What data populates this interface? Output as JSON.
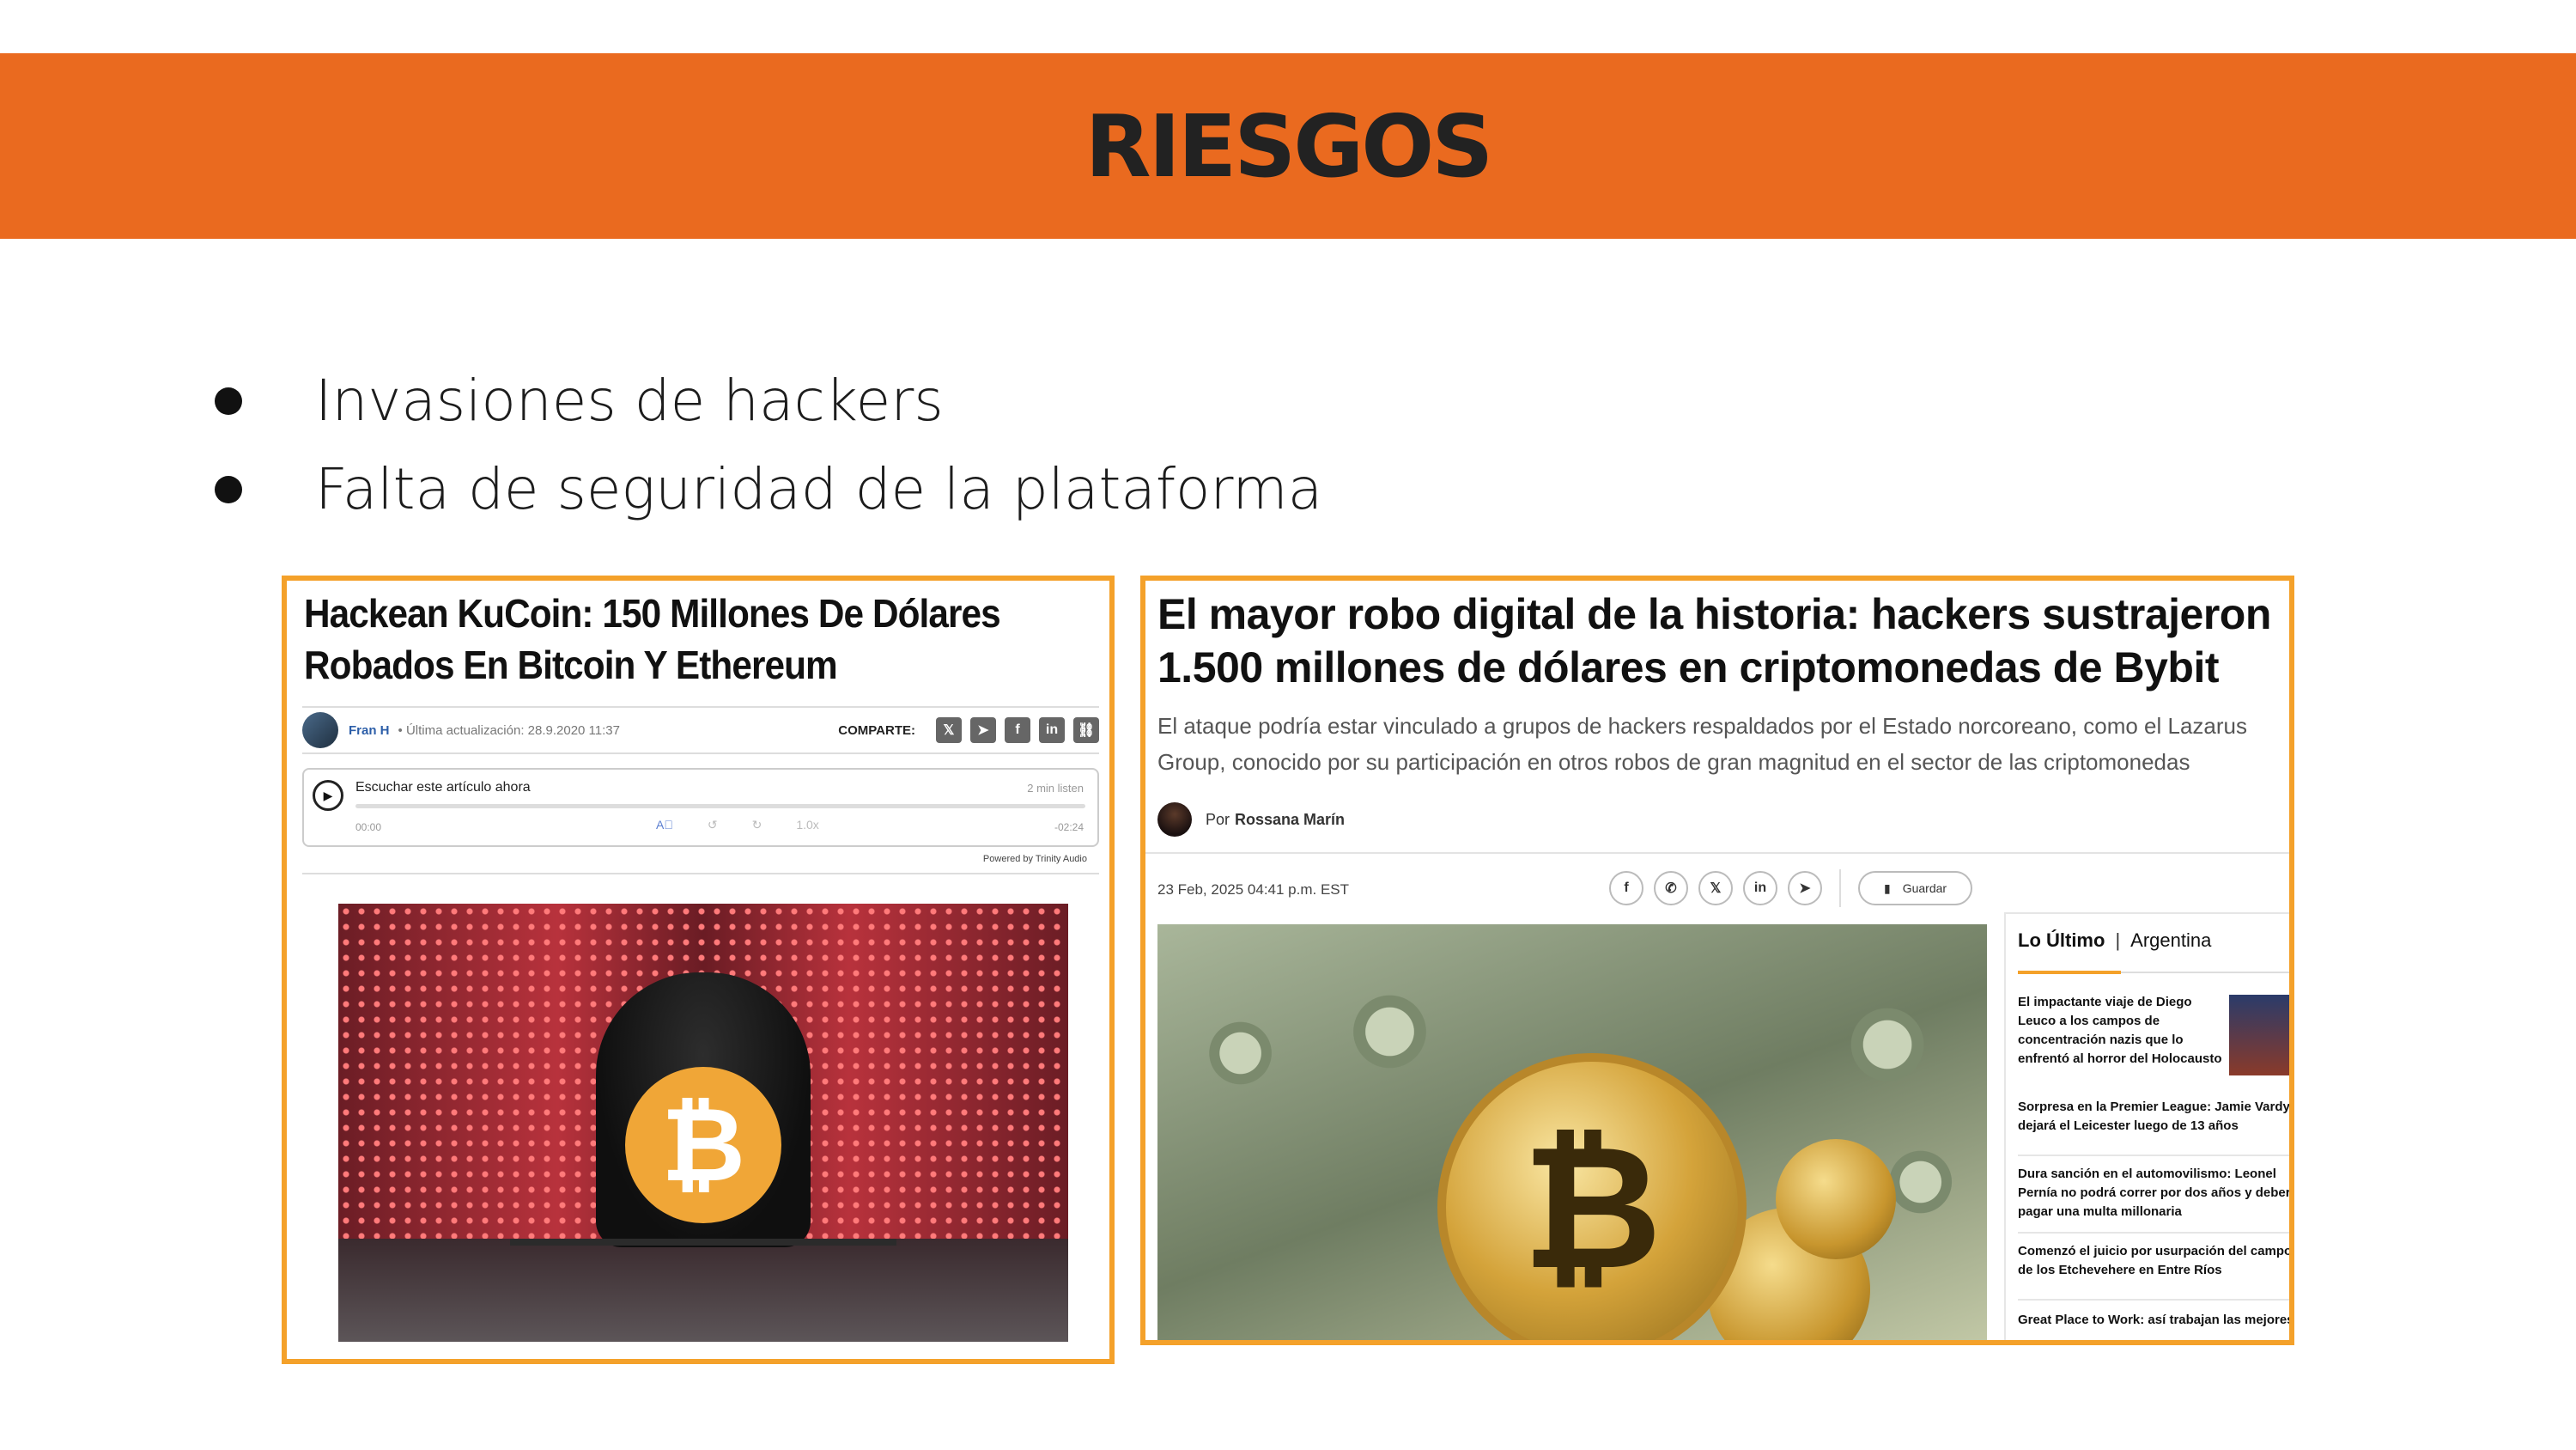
{
  "slide": {
    "title": "RIESGOS",
    "bullets": [
      "Invasiones de hackers",
      "Falta de seguridad de la plataforma"
    ]
  },
  "article1": {
    "title": "Hackean KuCoin: 150 Millones De Dólares Robados En Bitcoin Y Ethereum",
    "author": "Fran H",
    "updated": "Última actualización: 28.9.2020 11:37",
    "share_label": "COMPARTE:",
    "audio": {
      "label": "Escuchar este artículo ahora",
      "length": "2 min listen",
      "start": "00:00",
      "end": "-02:24",
      "speed": "1.0x"
    },
    "powered_by": "Powered by Trinity Audio"
  },
  "article2": {
    "title": "El mayor robo digital de la historia: hackers sustrajeron 1.500 millones de dólares en criptomonedas de Bybit",
    "subtitle": "El ataque podría estar vinculado a grupos de hackers respaldados por el Estado norcoreano, como el Lazarus Group, conocido por su participación en otros robos de gran magnitud en el sector de las criptomonedas",
    "byline_prefix": "Por",
    "author": "Rossana Marín",
    "date": "23 Feb, 2025 04:41 p.m. EST",
    "save_label": "Guardar",
    "sidebar": {
      "tab_latest": "Lo Último",
      "tab_region": "Argentina",
      "items": [
        "El impactante viaje de Diego Leuco a los campos de concentración nazis que lo enfrentó al horror del Holocausto",
        "Sorpresa en la Premier League: Jamie Vardy dejará el Leicester luego de 13 años",
        "Dura sanción en el automovilismo: Leonel Pernía no podrá correr por dos años y deberá pagar una multa millonaria",
        "Comenzó el juicio por usurpación del campo de los Etchevehere en Entre Ríos",
        "Great Place to Work: así trabajan las mejores"
      ]
    }
  },
  "icons": {
    "share": [
      "x-icon",
      "telegram-icon",
      "facebook-icon",
      "linkedin-icon",
      "link-icon"
    ],
    "share2": [
      "facebook-icon",
      "whatsapp-icon",
      "x-icon",
      "linkedin-icon",
      "telegram-icon"
    ]
  },
  "colors": {
    "banner": "#ea6a1f",
    "frame": "#f4a12a"
  }
}
